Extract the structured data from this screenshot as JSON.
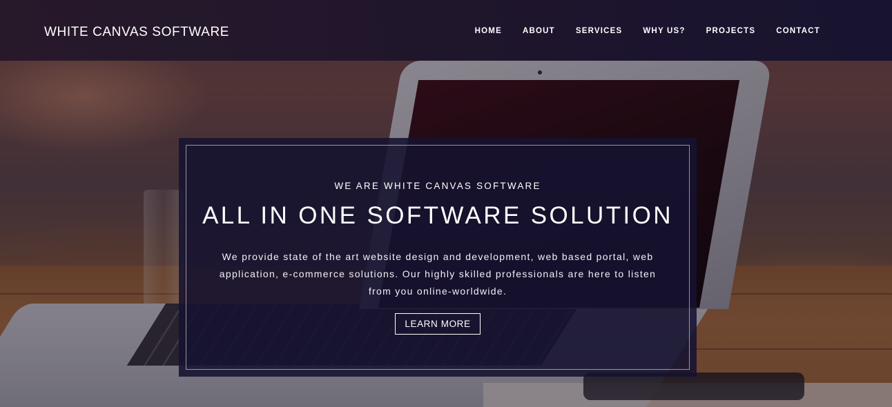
{
  "header": {
    "brand": "WHITE CANVAS SOFTWARE",
    "nav": [
      {
        "label": "HOME"
      },
      {
        "label": "ABOUT"
      },
      {
        "label": "SERVICES"
      },
      {
        "label": "WHY US?"
      },
      {
        "label": "PROJECTS"
      },
      {
        "label": "CONTACT"
      }
    ]
  },
  "hero": {
    "eyebrow": "WE ARE WHITE CANVAS SOFTWARE",
    "title": "ALL IN ONE SOFTWARE SOLUTION",
    "description": "We provide state of the art website design and development, web based portal, web application, e-commerce solutions. Our highly skilled professionals are here to listen from you online-worldwide.",
    "button_label": "LEARN MORE"
  },
  "colors": {
    "header_bg": "#1c1430",
    "card_bg": "#161230",
    "text": "#ffffff"
  }
}
